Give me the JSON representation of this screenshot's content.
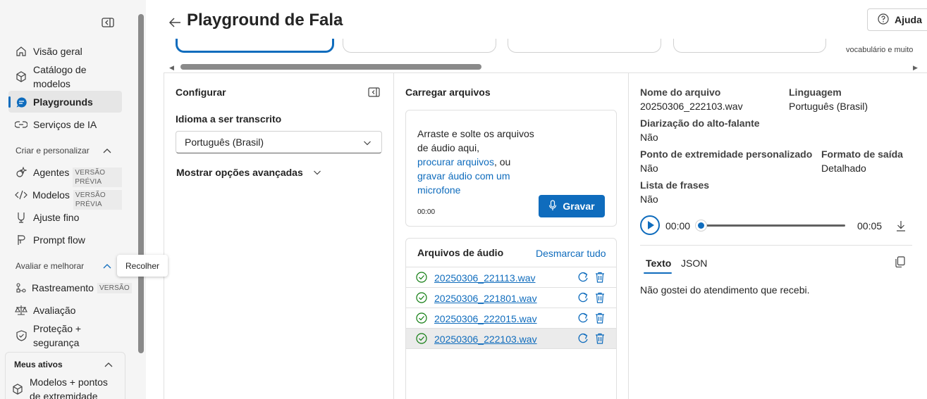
{
  "sidebar": {
    "items": [
      {
        "label": "Visão geral",
        "icon": "home-icon"
      },
      {
        "label": "Catálogo de modelos",
        "icon": "cube-icon"
      },
      {
        "label": "Playgrounds",
        "icon": "chat-icon",
        "active": true
      },
      {
        "label": "Serviços de IA",
        "icon": "link-icon"
      }
    ],
    "section_create": "Criar e personalizar",
    "create_items": [
      {
        "label": "Agentes",
        "badge": "VERSÃO PRÉVIA"
      },
      {
        "label": "Modelos",
        "badge": "VERSÃO PRÉVIA"
      },
      {
        "label": "Ajuste fino"
      },
      {
        "label": "Prompt flow"
      }
    ],
    "section_eval": "Avaliar e melhorar",
    "eval_items": [
      {
        "label": "Rastreamento",
        "badge": "VERSÃO"
      },
      {
        "label": "Avaliação"
      },
      {
        "label": "Proteção + segurança"
      }
    ],
    "section_assets": "Meus ativos",
    "asset_items": [
      {
        "label": "Modelos + pontos de extremidade"
      }
    ],
    "tooltip": "Recolher"
  },
  "header": {
    "title": "Playground de Fala",
    "help_label": "Ajuda"
  },
  "cards": {
    "partial_text": "vocabulário e muito"
  },
  "configure": {
    "title": "Configurar",
    "language_label": "Idioma a ser transcrito",
    "language_value": "Português (Brasil)",
    "advanced_label": "Mostrar opções avançadas"
  },
  "upload": {
    "title": "Carregar arquivos",
    "drop_text": "Arraste e solte os arquivos de áudio aqui,",
    "browse_link": "procurar arquivos",
    "or_text": ", ou",
    "record_link": "gravar áudio com um microfone",
    "timer": "00:00",
    "record_button": "Gravar"
  },
  "files": {
    "title": "Arquivos de áudio",
    "deselect_all": "Desmarcar tudo",
    "list": [
      {
        "name": "20250306_221113.wav",
        "selected": false
      },
      {
        "name": "20250306_221801.wav",
        "selected": false
      },
      {
        "name": "20250306_222015.wav",
        "selected": false
      },
      {
        "name": "20250306_222103.wav",
        "selected": true
      }
    ]
  },
  "details": {
    "file_name_label": "Nome do arquivo",
    "file_name_value": "20250306_222103.wav",
    "language_label": "Linguagem",
    "language_value": "Português (Brasil)",
    "diarization_label": "Diarização do alto-falante",
    "diarization_value": "Não",
    "endpoint_label": "Ponto de extremidade personalizado",
    "endpoint_value": "Não",
    "output_format_label": "Formato de saída",
    "output_format_value": "Detalhado",
    "phrase_list_label": "Lista de frases",
    "phrase_list_value": "Não",
    "time_start": "00:00",
    "time_end": "00:05",
    "playback_progress": 0,
    "tabs": [
      "Texto",
      "JSON"
    ],
    "transcript": "Não gostei do atendimento que recebi."
  },
  "colors": {
    "accent": "#0f6cbd",
    "sidebar_bg": "#f5f5f5",
    "selected_row": "#ebebeb"
  }
}
